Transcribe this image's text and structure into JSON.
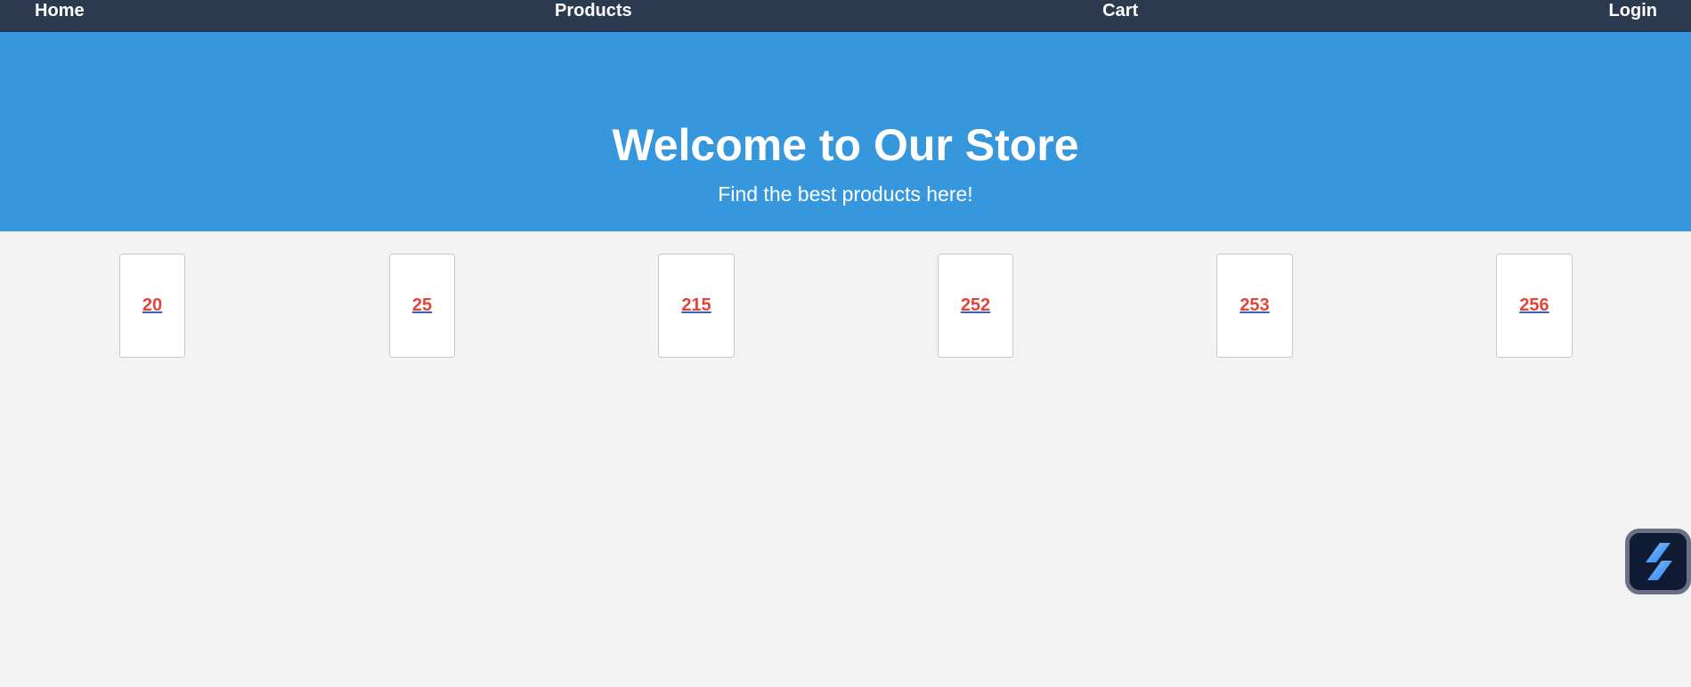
{
  "nav": {
    "items": [
      {
        "label": "Home"
      },
      {
        "label": "Products"
      },
      {
        "label": "Cart"
      },
      {
        "label": "Login"
      }
    ]
  },
  "hero": {
    "title": "Welcome to Our Store",
    "subtitle": "Find the best products here!"
  },
  "products": {
    "items": [
      {
        "label": "20"
      },
      {
        "label": "25"
      },
      {
        "label": "215"
      },
      {
        "label": "252"
      },
      {
        "label": "253"
      },
      {
        "label": "256"
      }
    ]
  },
  "fab": {
    "icon": "app-logo-icon"
  },
  "colors": {
    "nav_bg": "#2c3a4f",
    "hero_bg": "#3797dd",
    "page_bg": "#f3f3f3",
    "link_red": "#e3443a",
    "underline_blue": "#3a60b3"
  }
}
